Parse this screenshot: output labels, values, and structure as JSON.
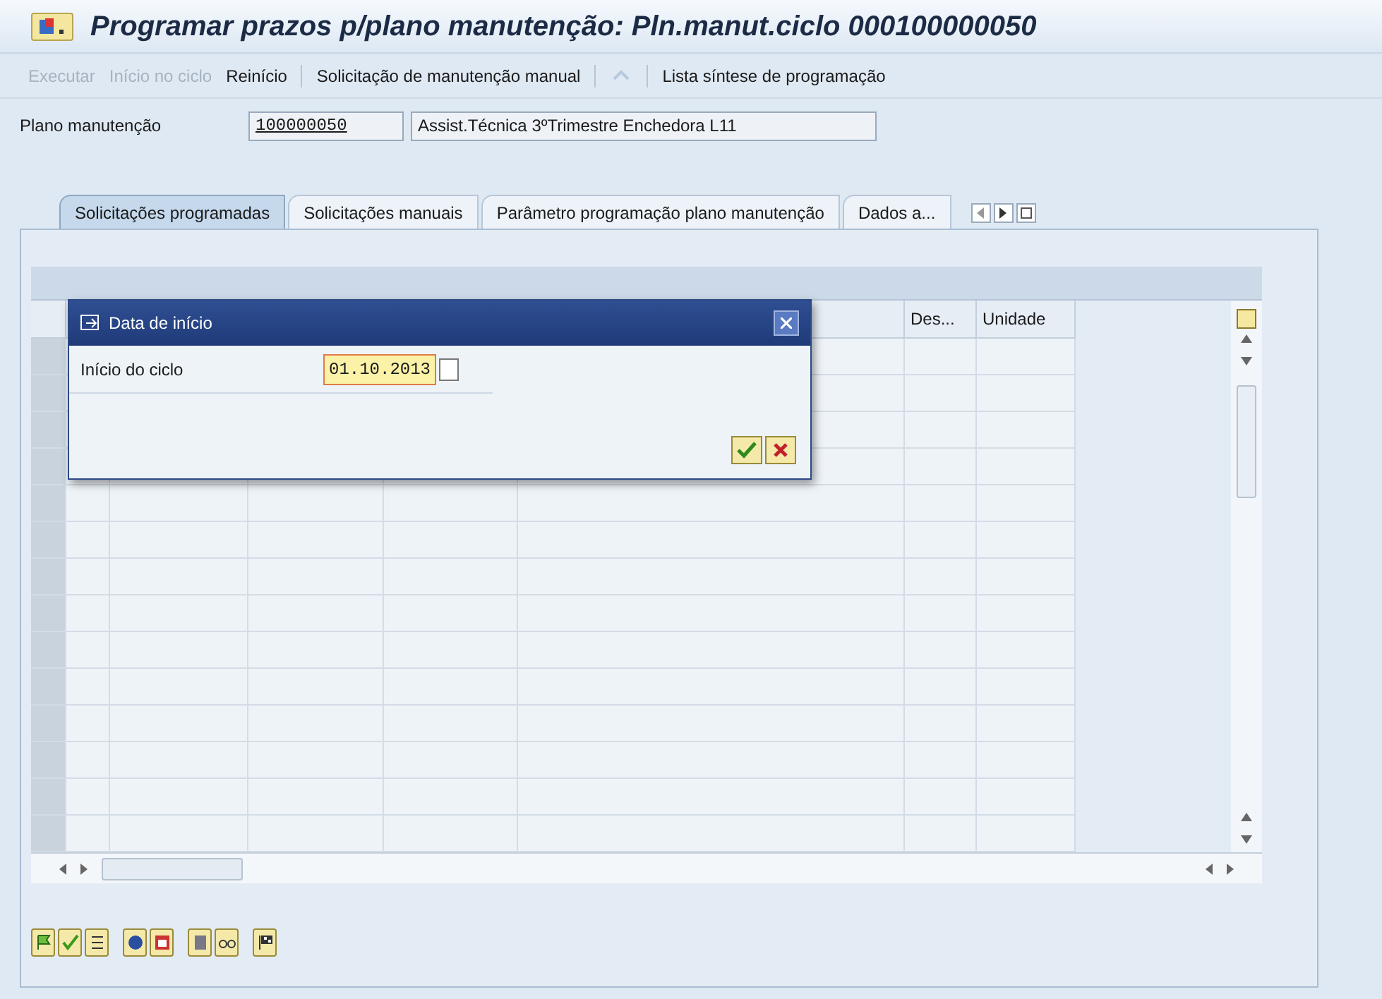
{
  "window": {
    "title": "Programar prazos p/plano manutenção: Pln.manut.ciclo 000100000050"
  },
  "toolbar": [
    {
      "label": "Executar",
      "disabled": true
    },
    {
      "label": "Início no ciclo",
      "disabled": true
    },
    {
      "label": "Reinício",
      "disabled": false
    },
    {
      "label": "Solicitação de manutenção manual",
      "disabled": false
    },
    {
      "label": "Lista síntese de programação",
      "disabled": false
    }
  ],
  "plan": {
    "label": "Plano manutenção",
    "value": "100000050",
    "description": "Assist.Técnica 3ºTrimestre Enchedora L11"
  },
  "tabs": [
    {
      "label": "Solicitações programadas",
      "selected": true
    },
    {
      "label": "Solicitações manuais",
      "selected": false
    },
    {
      "label": "Parâmetro programação plano manutenção",
      "selected": false
    },
    {
      "label": "Dados a...",
      "selected": false
    }
  ],
  "table": {
    "columns": [
      "Des...",
      "Unidade"
    ]
  },
  "dialog": {
    "title": "Data de início",
    "field_label": "Início do ciclo",
    "value": "01.10.2013"
  }
}
